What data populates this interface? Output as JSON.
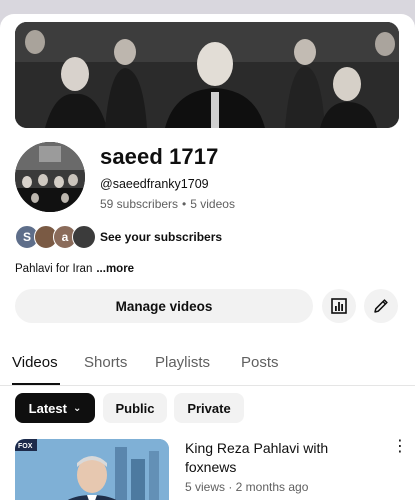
{
  "channel": {
    "name": "saeed 1717",
    "handle": "@saeedfranky1709",
    "subscribers": "59 subscribers",
    "separator": "•",
    "videos": "5 videos",
    "see_subscribers": "See your subscribers",
    "subscriber_avatars": [
      {
        "letter": "S",
        "color": "#5e6e8a"
      },
      {
        "letter": "",
        "color": "#7a5a44"
      },
      {
        "letter": "a",
        "color": "#8a6b5a"
      },
      {
        "letter": "",
        "color": "#3b3b3b"
      }
    ],
    "description": "Pahlavi for Iran",
    "more": "...more"
  },
  "actions": {
    "manage_videos": "Manage videos",
    "analytics_icon": "bar-chart-icon",
    "edit_icon": "pencil-icon"
  },
  "tabs": [
    {
      "label": "Videos",
      "active": true
    },
    {
      "label": "Shorts",
      "active": false
    },
    {
      "label": "Playlists",
      "active": false
    },
    {
      "label": "Posts",
      "active": false
    }
  ],
  "filters": {
    "latest": "Latest",
    "public": "Public",
    "private": "Private"
  },
  "video": {
    "title": "King Reza Pahlavi with foxnews",
    "meta": "5 views · 2 months ago",
    "thumb_logo": "FOX"
  },
  "colors": {
    "accent_dark": "#0f0f0f",
    "chip_bg": "#f2f2f2",
    "secondary_text": "#606060"
  }
}
